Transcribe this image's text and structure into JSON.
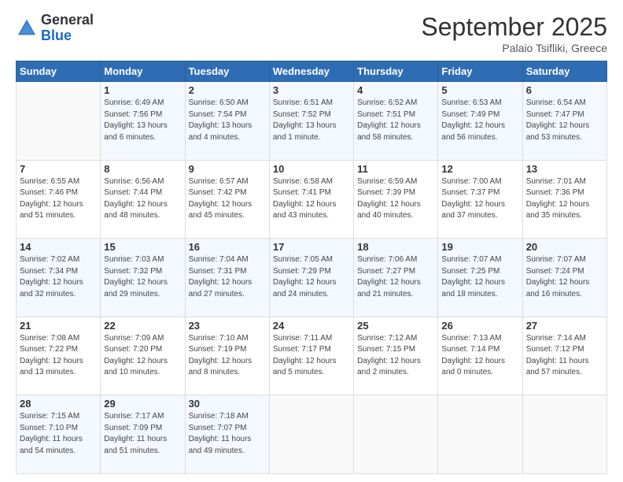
{
  "logo": {
    "general": "General",
    "blue": "Blue"
  },
  "header": {
    "month": "September 2025",
    "location": "Palaio Tsifliki, Greece"
  },
  "days_of_week": [
    "Sunday",
    "Monday",
    "Tuesday",
    "Wednesday",
    "Thursday",
    "Friday",
    "Saturday"
  ],
  "weeks": [
    [
      {
        "day": "",
        "info": ""
      },
      {
        "day": "1",
        "info": "Sunrise: 6:49 AM\nSunset: 7:56 PM\nDaylight: 13 hours\nand 6 minutes."
      },
      {
        "day": "2",
        "info": "Sunrise: 6:50 AM\nSunset: 7:54 PM\nDaylight: 13 hours\nand 4 minutes."
      },
      {
        "day": "3",
        "info": "Sunrise: 6:51 AM\nSunset: 7:52 PM\nDaylight: 13 hours\nand 1 minute."
      },
      {
        "day": "4",
        "info": "Sunrise: 6:52 AM\nSunset: 7:51 PM\nDaylight: 12 hours\nand 58 minutes."
      },
      {
        "day": "5",
        "info": "Sunrise: 6:53 AM\nSunset: 7:49 PM\nDaylight: 12 hours\nand 56 minutes."
      },
      {
        "day": "6",
        "info": "Sunrise: 6:54 AM\nSunset: 7:47 PM\nDaylight: 12 hours\nand 53 minutes."
      }
    ],
    [
      {
        "day": "7",
        "info": "Sunrise: 6:55 AM\nSunset: 7:46 PM\nDaylight: 12 hours\nand 51 minutes."
      },
      {
        "day": "8",
        "info": "Sunrise: 6:56 AM\nSunset: 7:44 PM\nDaylight: 12 hours\nand 48 minutes."
      },
      {
        "day": "9",
        "info": "Sunrise: 6:57 AM\nSunset: 7:42 PM\nDaylight: 12 hours\nand 45 minutes."
      },
      {
        "day": "10",
        "info": "Sunrise: 6:58 AM\nSunset: 7:41 PM\nDaylight: 12 hours\nand 43 minutes."
      },
      {
        "day": "11",
        "info": "Sunrise: 6:59 AM\nSunset: 7:39 PM\nDaylight: 12 hours\nand 40 minutes."
      },
      {
        "day": "12",
        "info": "Sunrise: 7:00 AM\nSunset: 7:37 PM\nDaylight: 12 hours\nand 37 minutes."
      },
      {
        "day": "13",
        "info": "Sunrise: 7:01 AM\nSunset: 7:36 PM\nDaylight: 12 hours\nand 35 minutes."
      }
    ],
    [
      {
        "day": "14",
        "info": "Sunrise: 7:02 AM\nSunset: 7:34 PM\nDaylight: 12 hours\nand 32 minutes."
      },
      {
        "day": "15",
        "info": "Sunrise: 7:03 AM\nSunset: 7:32 PM\nDaylight: 12 hours\nand 29 minutes."
      },
      {
        "day": "16",
        "info": "Sunrise: 7:04 AM\nSunset: 7:31 PM\nDaylight: 12 hours\nand 27 minutes."
      },
      {
        "day": "17",
        "info": "Sunrise: 7:05 AM\nSunset: 7:29 PM\nDaylight: 12 hours\nand 24 minutes."
      },
      {
        "day": "18",
        "info": "Sunrise: 7:06 AM\nSunset: 7:27 PM\nDaylight: 12 hours\nand 21 minutes."
      },
      {
        "day": "19",
        "info": "Sunrise: 7:07 AM\nSunset: 7:25 PM\nDaylight: 12 hours\nand 18 minutes."
      },
      {
        "day": "20",
        "info": "Sunrise: 7:07 AM\nSunset: 7:24 PM\nDaylight: 12 hours\nand 16 minutes."
      }
    ],
    [
      {
        "day": "21",
        "info": "Sunrise: 7:08 AM\nSunset: 7:22 PM\nDaylight: 12 hours\nand 13 minutes."
      },
      {
        "day": "22",
        "info": "Sunrise: 7:09 AM\nSunset: 7:20 PM\nDaylight: 12 hours\nand 10 minutes."
      },
      {
        "day": "23",
        "info": "Sunrise: 7:10 AM\nSunset: 7:19 PM\nDaylight: 12 hours\nand 8 minutes."
      },
      {
        "day": "24",
        "info": "Sunrise: 7:11 AM\nSunset: 7:17 PM\nDaylight: 12 hours\nand 5 minutes."
      },
      {
        "day": "25",
        "info": "Sunrise: 7:12 AM\nSunset: 7:15 PM\nDaylight: 12 hours\nand 2 minutes."
      },
      {
        "day": "26",
        "info": "Sunrise: 7:13 AM\nSunset: 7:14 PM\nDaylight: 12 hours\nand 0 minutes."
      },
      {
        "day": "27",
        "info": "Sunrise: 7:14 AM\nSunset: 7:12 PM\nDaylight: 11 hours\nand 57 minutes."
      }
    ],
    [
      {
        "day": "28",
        "info": "Sunrise: 7:15 AM\nSunset: 7:10 PM\nDaylight: 11 hours\nand 54 minutes."
      },
      {
        "day": "29",
        "info": "Sunrise: 7:17 AM\nSunset: 7:09 PM\nDaylight: 11 hours\nand 51 minutes."
      },
      {
        "day": "30",
        "info": "Sunrise: 7:18 AM\nSunset: 7:07 PM\nDaylight: 11 hours\nand 49 minutes."
      },
      {
        "day": "",
        "info": ""
      },
      {
        "day": "",
        "info": ""
      },
      {
        "day": "",
        "info": ""
      },
      {
        "day": "",
        "info": ""
      }
    ]
  ]
}
